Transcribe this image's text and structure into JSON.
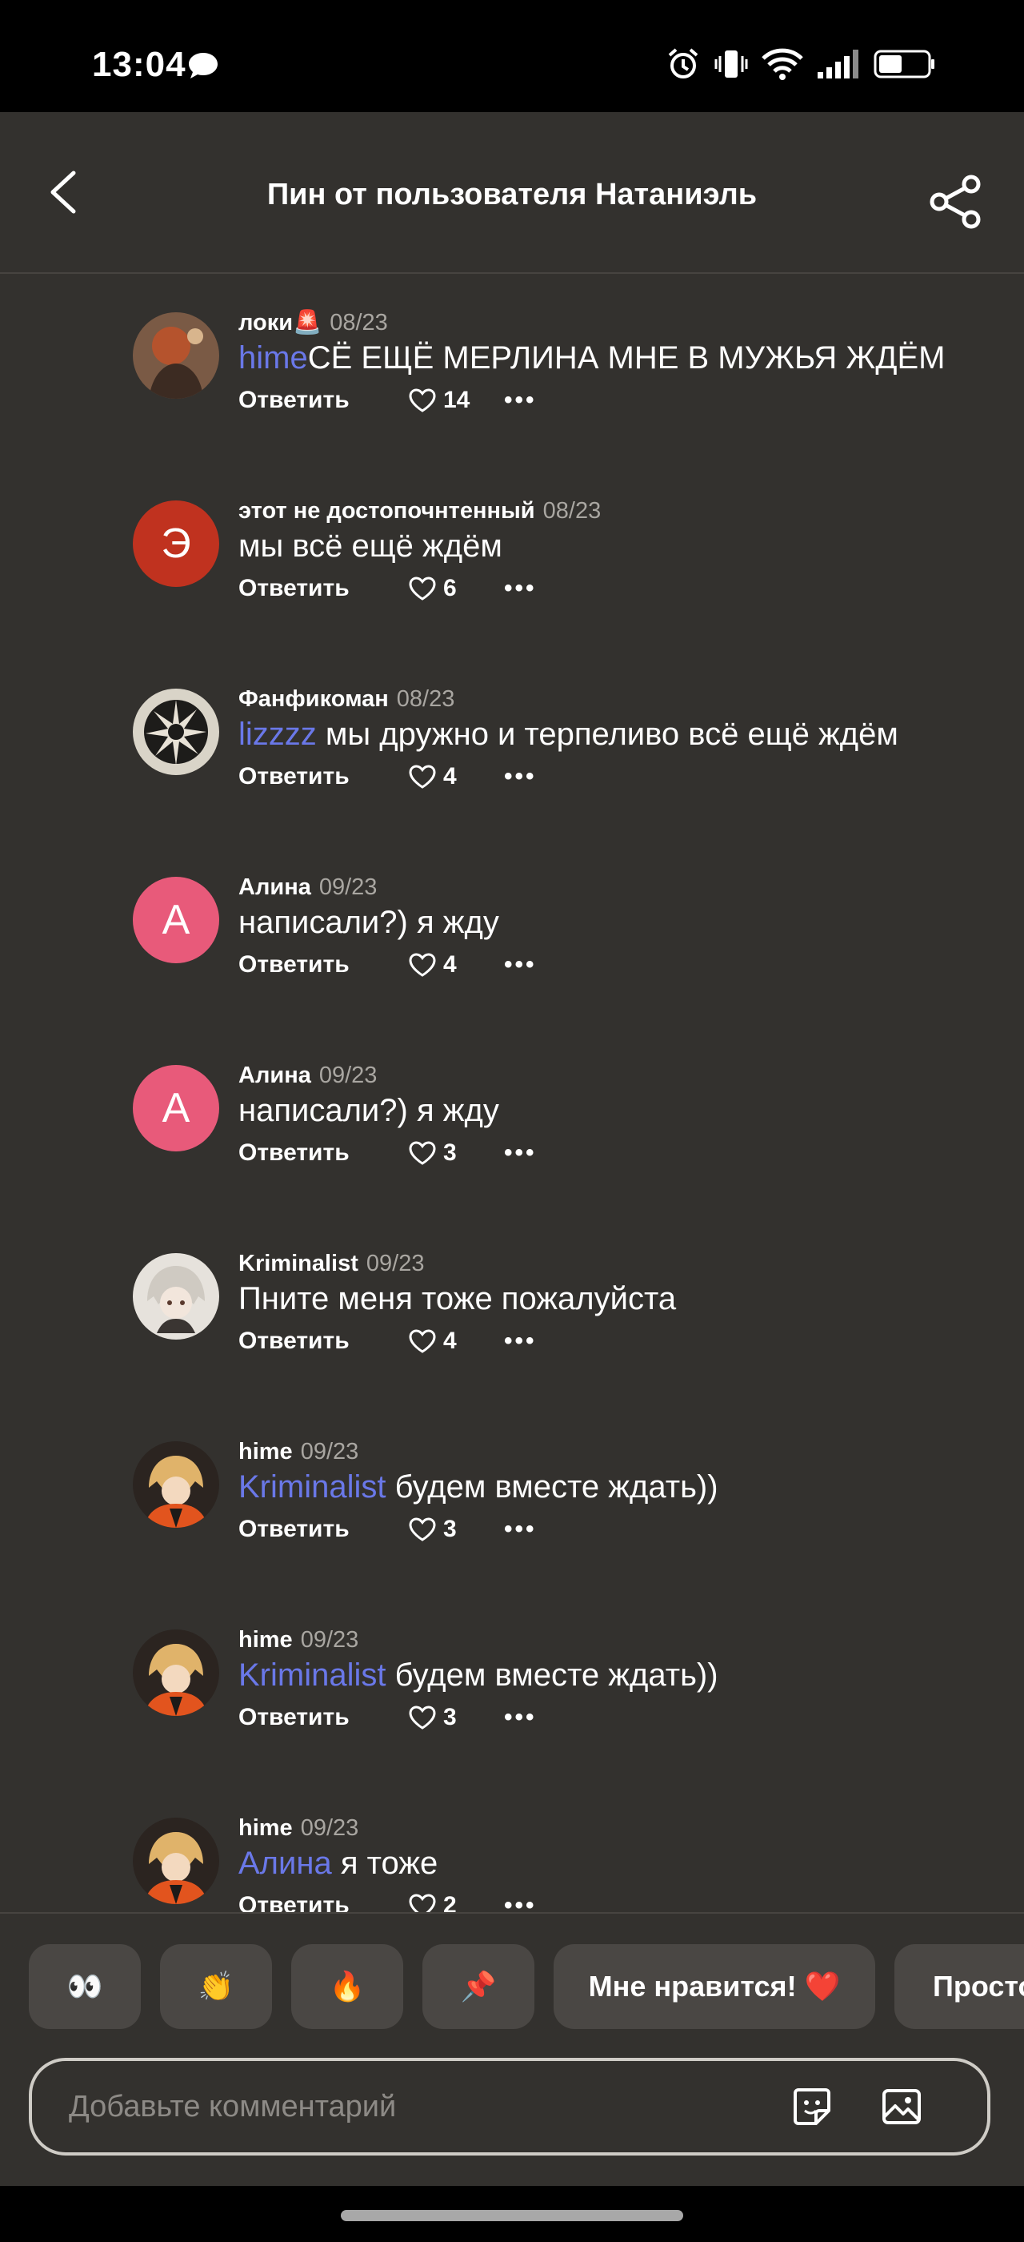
{
  "status": {
    "time": "13:04"
  },
  "header": {
    "title": "Пин от пользователя Натаниэль"
  },
  "reply_label": "Ответить",
  "comments": [
    {
      "author": "локи🚨",
      "date": "08/23",
      "mention": "hime",
      "text": "СЁ ЕЩЁ МЕРЛИНА МНЕ В МУЖЬЯ ЖДЁМ",
      "likes": "14",
      "avatar": "loki"
    },
    {
      "author": "этот не достопочнтенный",
      "date": "08/23",
      "mention": "",
      "text": "мы всё ещё ждём",
      "likes": "6",
      "avatar": "Э"
    },
    {
      "author": "Фанфикоман",
      "date": "08/23",
      "mention": "lizzzz",
      "text": " мы дружно и терпеливо всё ещё ждём",
      "likes": "4",
      "avatar": "fanfik"
    },
    {
      "author": "Алина",
      "date": "09/23",
      "mention": "",
      "text": "написали?) я жду",
      "likes": "4",
      "avatar": "А"
    },
    {
      "author": "Алина",
      "date": "09/23",
      "mention": "",
      "text": "написали?) я жду",
      "likes": "3",
      "avatar": "А"
    },
    {
      "author": "Kriminalist",
      "date": "09/23",
      "mention": "",
      "text": "Пните меня тоже пожалуйста",
      "likes": "4",
      "avatar": "krim"
    },
    {
      "author": "hime",
      "date": "09/23",
      "mention": "Kriminalist",
      "text": " будем вместе ждать))",
      "likes": "3",
      "avatar": "hime"
    },
    {
      "author": "hime",
      "date": "09/23",
      "mention": "Kriminalist",
      "text": " будем вместе ждать))",
      "likes": "3",
      "avatar": "hime"
    },
    {
      "author": "hime",
      "date": "09/23",
      "mention": "Алина",
      "text": " я тоже",
      "likes": "2",
      "avatar": "hime"
    }
  ],
  "reactions": [
    "👀",
    "👏",
    "🔥",
    "📌",
    "Мне нравится! ❤️",
    "Просто"
  ],
  "composer": {
    "placeholder": "Добавьте комментарий"
  },
  "colors": {
    "background": "#33312e",
    "mention": "#6a78e8",
    "avatar_red": "#c0321f",
    "avatar_pink": "#e85a7a"
  }
}
